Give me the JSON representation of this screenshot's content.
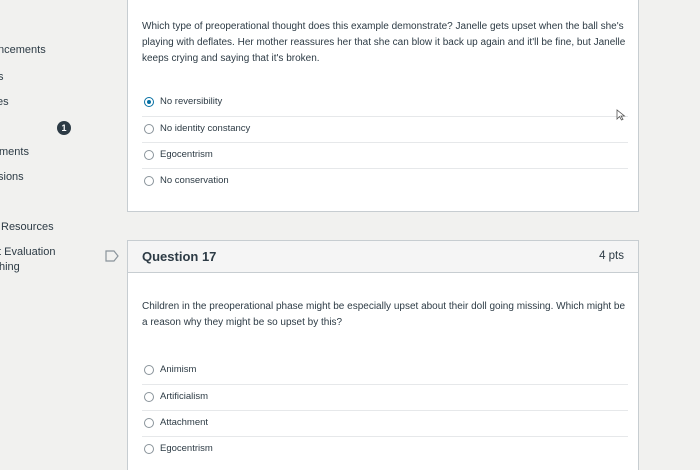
{
  "sidebar": {
    "items": [
      {
        "label": "ncements"
      },
      {
        "label": "s"
      },
      {
        "label": "es"
      },
      {
        "label": "ments"
      },
      {
        "label": "sions"
      },
      {
        "label": "Resources"
      },
      {
        "label": "t Evaluation"
      },
      {
        "label": "hing"
      }
    ],
    "badge": "1"
  },
  "question16": {
    "text": "Which type of preoperational thought does this example demonstrate? Janelle gets upset when the ball she's playing with deflates. Her mother reassures her that she can blow it back up again and it'll be fine, but Janelle keeps crying and saying that it's broken.",
    "answers": [
      {
        "label": "No reversibility",
        "selected": true
      },
      {
        "label": "No identity constancy",
        "selected": false
      },
      {
        "label": "Egocentrism",
        "selected": false
      },
      {
        "label": "No conservation",
        "selected": false
      }
    ]
  },
  "question17": {
    "title": "Question 17",
    "points": "4 pts",
    "text": "Children in the preoperational phase might be especially upset about their doll going missing. Which might be a reason why they might be so upset by this?",
    "answers": [
      {
        "label": "Animism",
        "selected": false
      },
      {
        "label": "Artificialism",
        "selected": false
      },
      {
        "label": "Attachment",
        "selected": false
      },
      {
        "label": "Egocentrism",
        "selected": false
      }
    ]
  },
  "icons": {
    "flag": "flag-question-icon",
    "cursor": "mouse-pointer-icon"
  },
  "colors": {
    "accent": "#0770a3",
    "text": "#2d3b45",
    "border": "#c7cdd1"
  }
}
